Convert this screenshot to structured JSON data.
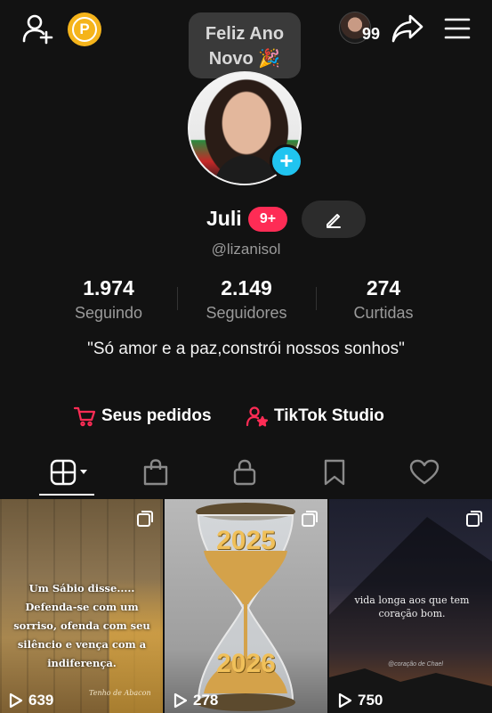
{
  "top_bar": {
    "coin_letter": "P",
    "note_text": "Feliz Ano Novo 🎉",
    "friends_count": "99"
  },
  "profile": {
    "display_name": "Juli",
    "notification_badge": "9+",
    "username": "@lizanisol",
    "bio": "\"Só amor e a paz,constrói  nossos sonhos\""
  },
  "stats": [
    {
      "value": "1.974",
      "label": "Seguindo"
    },
    {
      "value": "2.149",
      "label": "Seguidores"
    },
    {
      "value": "274",
      "label": "Curtidas"
    }
  ],
  "links": {
    "orders": "Seus pedidos",
    "studio": "TikTok Studio"
  },
  "colors": {
    "background": "#121212",
    "accent_red": "#fe2c55",
    "plus_blue": "#20c4f0",
    "coin_gold": "#f5b41b"
  },
  "videos": [
    {
      "views": "639",
      "caption": "Um Sábio disse..... Defenda-se com um sorriso, ofenda com seu silêncio e vença com a indiferença.",
      "signature": "Tenho de Abacon"
    },
    {
      "views": "278",
      "caption_top": "2025",
      "caption_bottom": "2026"
    },
    {
      "views": "750",
      "caption": "vida longa aos que tem coração bom.",
      "handle": "@coração de Chael"
    }
  ]
}
